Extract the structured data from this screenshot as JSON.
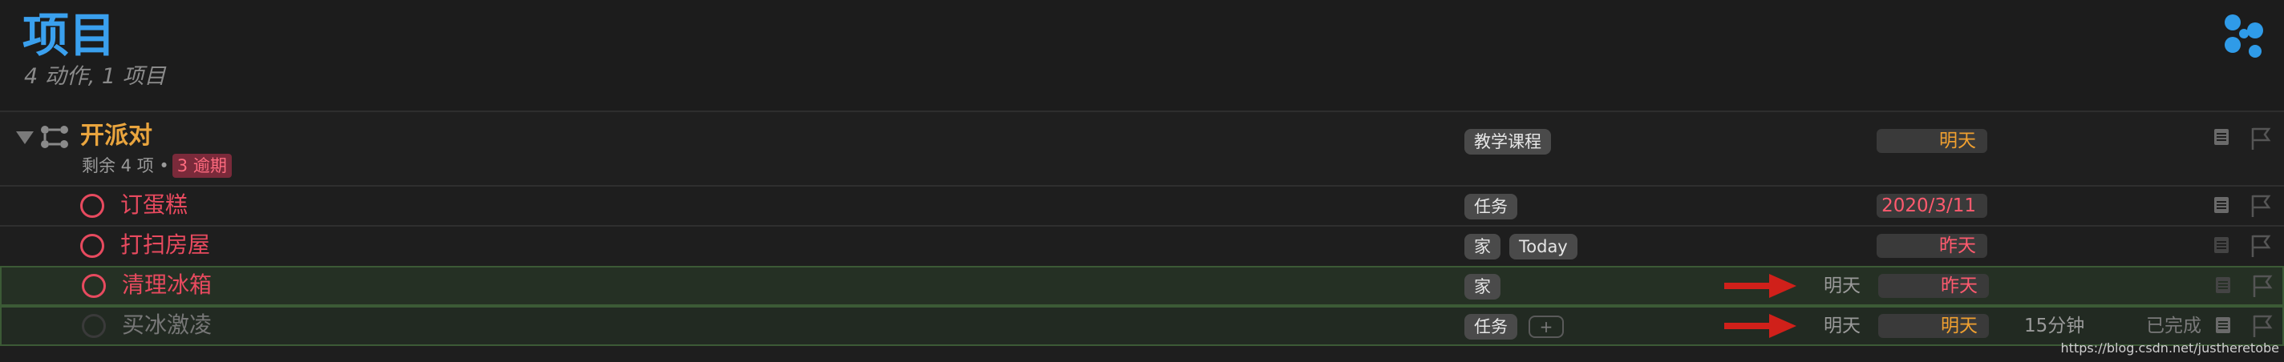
{
  "header": {
    "title": "项目",
    "subtitle": "4 动作, 1 项目"
  },
  "icons": {
    "perspective": "perspective-dots-icon",
    "project": "project-sequential-icon",
    "note": "note-icon",
    "flag": "flag-icon",
    "arrow": "red-arrow-icon"
  },
  "project": {
    "name": "开派对",
    "remaining": "剩余 4 项 •",
    "overdue": "3 逾期",
    "tag": "教学课程",
    "due": "明天"
  },
  "tasks": [
    {
      "name": "订蛋糕",
      "tags": [
        "任务"
      ],
      "due": "2020/3/11"
    },
    {
      "name": "打扫房屋",
      "tags": [
        "家",
        "Today"
      ],
      "due": "昨天"
    },
    {
      "name": "清理冰箱",
      "tags": [
        "家"
      ],
      "defer": "明天",
      "due": "昨天"
    },
    {
      "name": "买冰激凌",
      "tags": [
        "任务"
      ],
      "tag_add": "+",
      "defer": "明天",
      "due": "明天",
      "duration": "15分钟",
      "completed": "已完成"
    }
  ],
  "colors": {
    "title_blue": "#3aa0ee",
    "project_orange": "#eaa53e",
    "overdue_red": "#e84a5f",
    "due_orange": "#f0a030",
    "due_red": "#ff5a6e",
    "selection_green": "#3c5a36",
    "arrow_red": "#d0201a"
  },
  "watermark": "https://blog.csdn.net/justheretobe"
}
